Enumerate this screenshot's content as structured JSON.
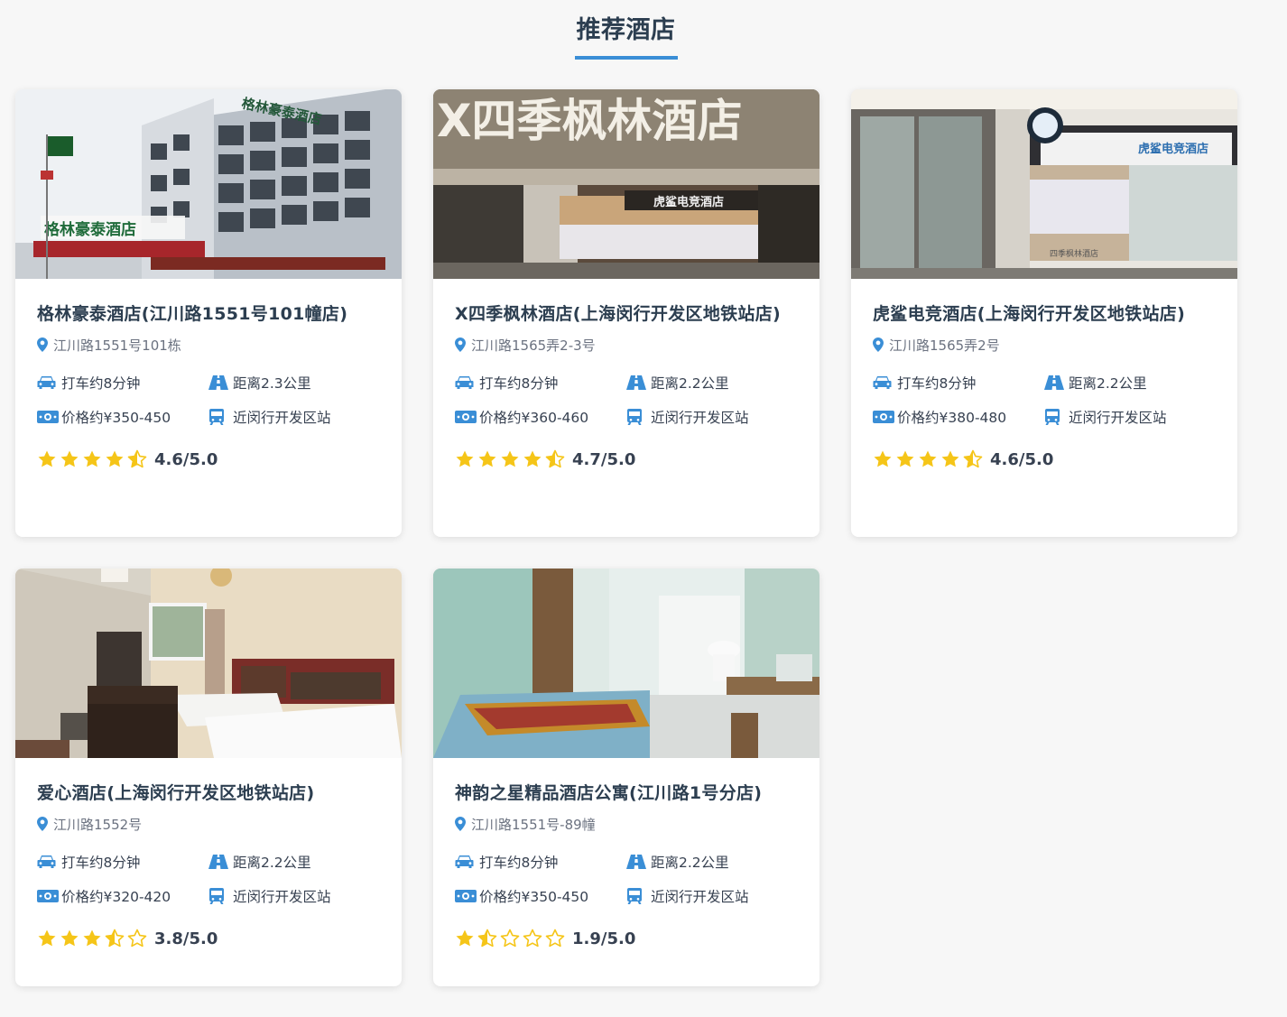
{
  "section": {
    "title": "推荐酒店"
  },
  "colors": {
    "accent": "#3a8ed6",
    "star": "#f5c518",
    "text": "#2c3e50"
  },
  "hotels": [
    {
      "name": "格林豪泰酒店(江川路1551号101幢店)",
      "address": "江川路1551号101栋",
      "taxi": "打车约8分钟",
      "distance": "距离2.3公里",
      "price": "价格约¥350-450",
      "station": "近闵行开发区站",
      "rating": 4.6,
      "rating_text": "4.6/5.0",
      "photo_sign": "格林豪泰酒店",
      "photo_sign_2": "格林豪泰酒店"
    },
    {
      "name": "X四季枫林酒店(上海闵行开发区地铁站店)",
      "address": "江川路1565弄2-3号",
      "taxi": "打车约8分钟",
      "distance": "距离2.2公里",
      "price": "价格约¥360-460",
      "station": "近闵行开发区站",
      "rating": 4.7,
      "rating_text": "4.7/5.0",
      "photo_sign": "X四季枫林酒店",
      "photo_sign_2": "虎鲨电竞酒店"
    },
    {
      "name": "虎鲨电竞酒店(上海闵行开发区地铁站店)",
      "address": "江川路1565弄2号",
      "taxi": "打车约8分钟",
      "distance": "距离2.2公里",
      "price": "价格约¥380-480",
      "station": "近闵行开发区站",
      "rating": 4.6,
      "rating_text": "4.6/5.0",
      "photo_sign": "虎鲨电竞酒店",
      "photo_sign_2": "四季枫林酒店"
    },
    {
      "name": "爱心酒店(上海闵行开发区地铁站店)",
      "address": "江川路1552号",
      "taxi": "打车约8分钟",
      "distance": "距离2.2公里",
      "price": "价格约¥320-420",
      "station": "近闵行开发区站",
      "rating": 3.8,
      "rating_text": "3.8/5.0"
    },
    {
      "name": "神韵之星精品酒店公寓(江川路1号分店)",
      "address": "江川路1551号-89幢",
      "taxi": "打车约8分钟",
      "distance": "距离2.2公里",
      "price": "价格约¥350-450",
      "station": "近闵行开发区站",
      "rating": 1.9,
      "rating_text": "1.9/5.0"
    }
  ]
}
